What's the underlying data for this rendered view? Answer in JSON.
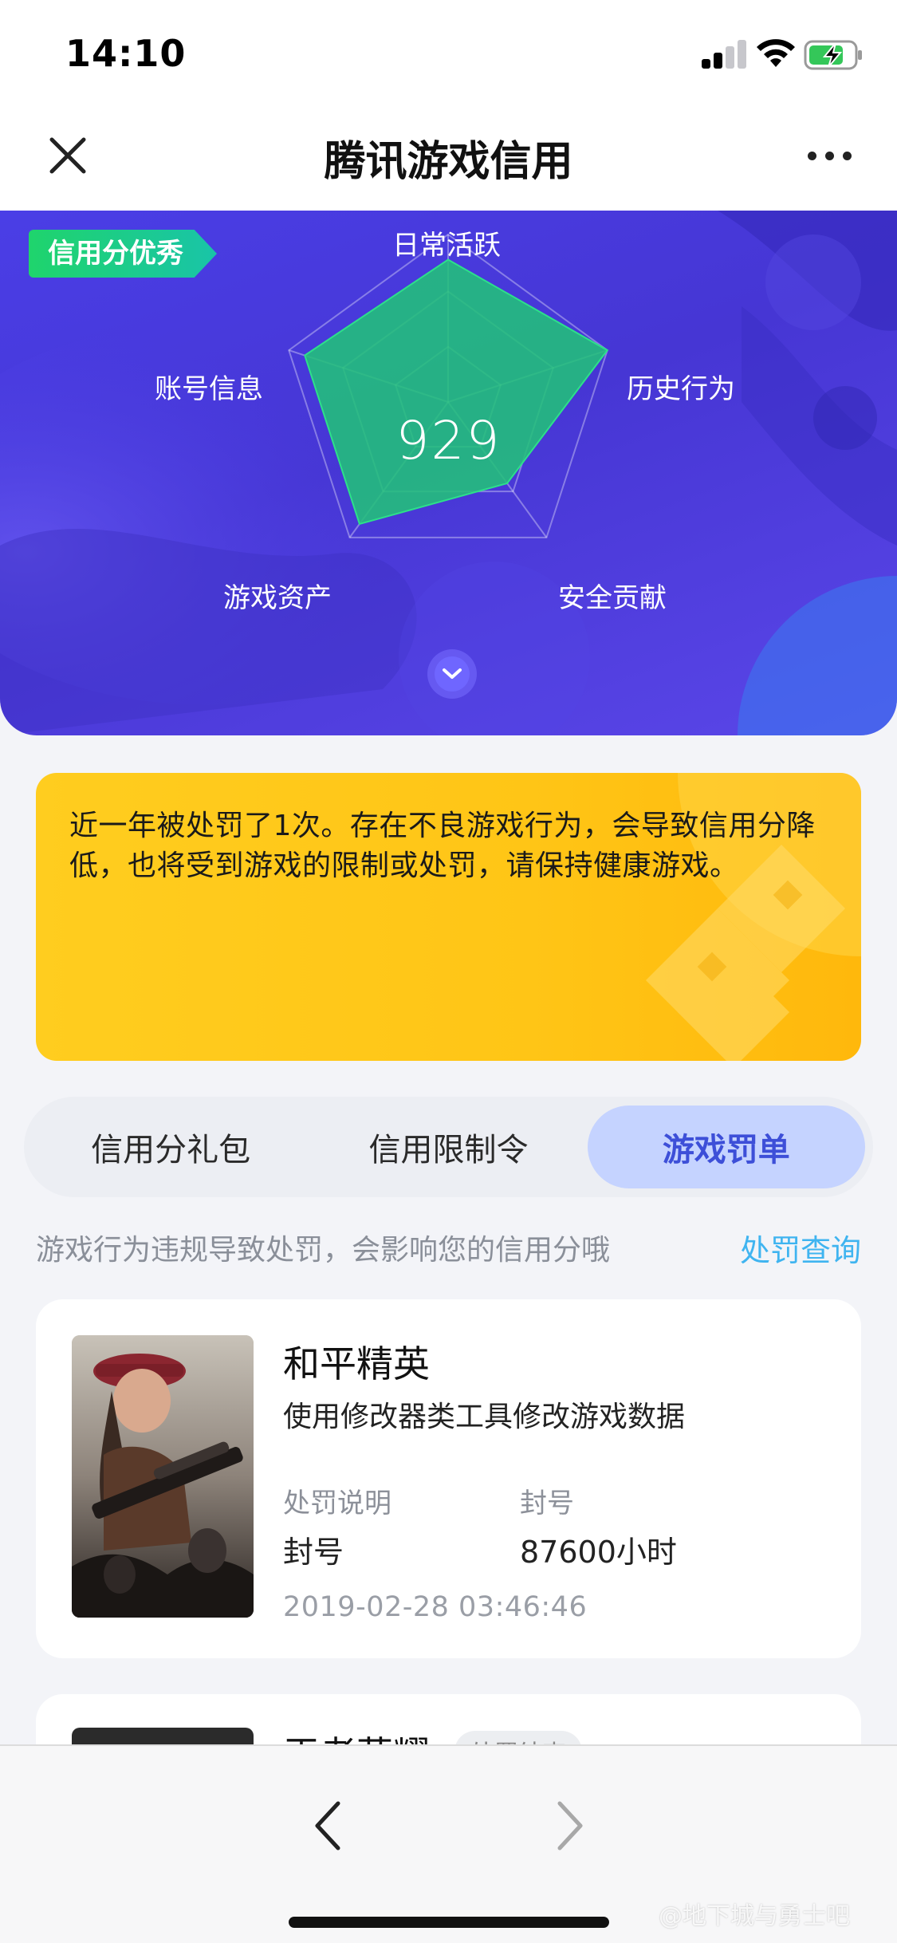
{
  "status_bar": {
    "time": "14:10"
  },
  "header": {
    "title": "腾讯游戏信用"
  },
  "credit": {
    "badge": "信用分优秀",
    "score": "929",
    "axes": {
      "daily": "日常活跃",
      "history": "历史行为",
      "security": "安全贡献",
      "assets": "游戏资产",
      "account": "账号信息"
    },
    "axis_levels": {
      "daily": 0.85,
      "history": 1.0,
      "security": 0.6,
      "assets": 0.9,
      "account": 0.9
    },
    "accent_color": "#1fd46c"
  },
  "notice": {
    "text": "近一年被处罚了1次。存在不良游戏行为，会导致信用分降低，也将受到游戏的限制或处罚，请保持健康游戏。"
  },
  "tabs": [
    {
      "label": "信用分礼包",
      "active": false
    },
    {
      "label": "信用限制令",
      "active": false
    },
    {
      "label": "游戏罚单",
      "active": true
    }
  ],
  "penalty_section": {
    "hint": "游戏行为违规导致处罚，会影响您的信用分哦",
    "query_link": "处罚查询"
  },
  "records": [
    {
      "game": "和平精英",
      "reason": "使用修改器类工具修改游戏数据",
      "desc_label": "处罚说明",
      "desc_value": "封号",
      "type_label": "封号",
      "duration": "87600小时",
      "time": "2019-02-28 03:46:46"
    },
    {
      "game": "王者荣耀",
      "status": "处罚结束"
    }
  ],
  "watermark": "@地下城与勇士吧"
}
